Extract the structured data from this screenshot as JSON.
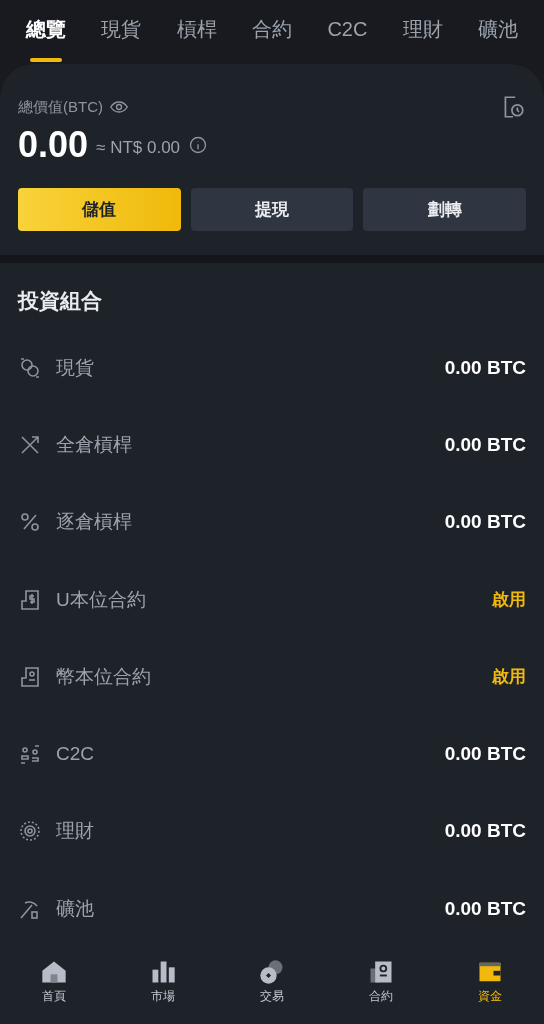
{
  "tabs": [
    {
      "label": "總覽",
      "selected": true
    },
    {
      "label": "現貨",
      "selected": false
    },
    {
      "label": "槓桿",
      "selected": false
    },
    {
      "label": "合約",
      "selected": false
    },
    {
      "label": "C2C",
      "selected": false
    },
    {
      "label": "理財",
      "selected": false
    },
    {
      "label": "礦池",
      "selected": false
    }
  ],
  "summary": {
    "label": "總價值(BTC)",
    "amount": "0.00",
    "fiat": "≈ NT$ 0.00"
  },
  "actions": [
    {
      "label": "儲值",
      "kind": "primary"
    },
    {
      "label": "提現",
      "kind": "secondary"
    },
    {
      "label": "劃轉",
      "kind": "secondary"
    }
  ],
  "portfolio": {
    "title": "投資組合",
    "rows": [
      {
        "name": "現貨",
        "kind": "balance",
        "value": "0.00 BTC"
      },
      {
        "name": "全倉槓桿",
        "kind": "balance",
        "value": "0.00 BTC"
      },
      {
        "name": "逐倉槓桿",
        "kind": "balance",
        "value": "0.00 BTC"
      },
      {
        "name": "U本位合約",
        "kind": "enable",
        "value": "啟用"
      },
      {
        "name": "幣本位合約",
        "kind": "enable",
        "value": "啟用"
      },
      {
        "name": "C2C",
        "kind": "balance",
        "value": "0.00 BTC"
      },
      {
        "name": "理財",
        "kind": "balance",
        "value": "0.00 BTC"
      },
      {
        "name": "礦池",
        "kind": "balance",
        "value": "0.00 BTC"
      }
    ]
  },
  "bottom_nav": [
    {
      "label": "首頁",
      "selected": false
    },
    {
      "label": "市場",
      "selected": false
    },
    {
      "label": "交易",
      "selected": false
    },
    {
      "label": "合約",
      "selected": false
    },
    {
      "label": "資金",
      "selected": true
    }
  ]
}
